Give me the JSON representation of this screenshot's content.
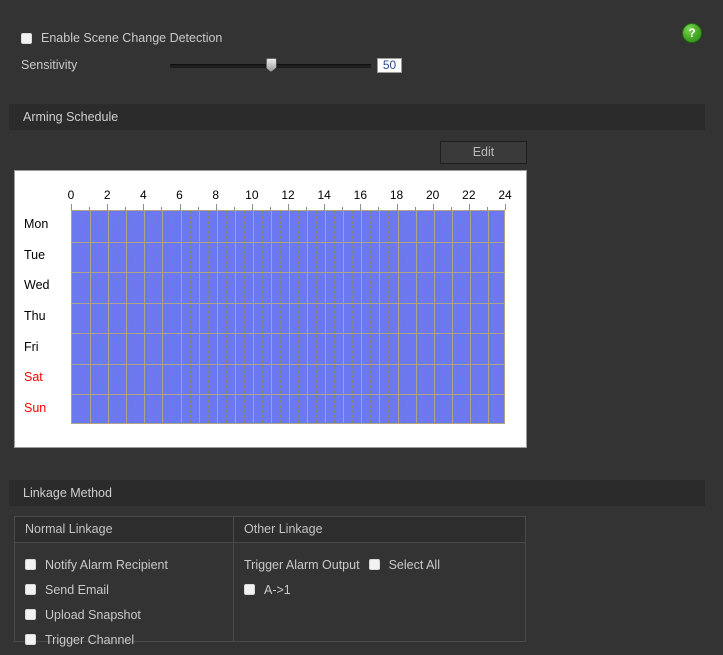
{
  "top": {
    "enable_checkbox_label": "Enable Scene Change Detection",
    "enable_checked": false,
    "sensitivity_label": "Sensitivity",
    "sensitivity_value": "50",
    "help_icon_glyph": "?"
  },
  "arming": {
    "section_title": "Arming Schedule",
    "edit_label": "Edit",
    "hour_labels": [
      "0",
      "2",
      "4",
      "6",
      "8",
      "10",
      "12",
      "14",
      "16",
      "18",
      "20",
      "22",
      "24"
    ],
    "days": [
      {
        "label": "Mon",
        "weekend": false
      },
      {
        "label": "Tue",
        "weekend": false
      },
      {
        "label": "Wed",
        "weekend": false
      },
      {
        "label": "Thu",
        "weekend": false
      },
      {
        "label": "Fri",
        "weekend": false
      },
      {
        "label": "Sat",
        "weekend": true
      },
      {
        "label": "Sun",
        "weekend": true
      }
    ],
    "schedule_fill_color": "#6b78ef",
    "gridline_color": "#aca584",
    "weekend_label_color": "#ff0000",
    "armed_all_day": true
  },
  "linkage": {
    "section_title": "Linkage Method",
    "col_normal_header": "Normal Linkage",
    "col_other_header": "Other Linkage",
    "normal_items": [
      {
        "label": "Notify Alarm Recipient",
        "checked": false
      },
      {
        "label": "Send Email",
        "checked": false
      },
      {
        "label": "Upload Snapshot",
        "checked": false
      },
      {
        "label": "Trigger Channel",
        "checked": false
      }
    ],
    "other": {
      "trigger_alarm_output_label": "Trigger Alarm Output",
      "select_all_label": "Select All",
      "select_all_checked": false,
      "outputs": [
        {
          "label": "A->1",
          "checked": false
        }
      ]
    }
  },
  "theme": {
    "background": "#333333",
    "section_bar": "#2b2b2b",
    "text": "#c9c9c9",
    "accent_green": "#4caf2a"
  }
}
